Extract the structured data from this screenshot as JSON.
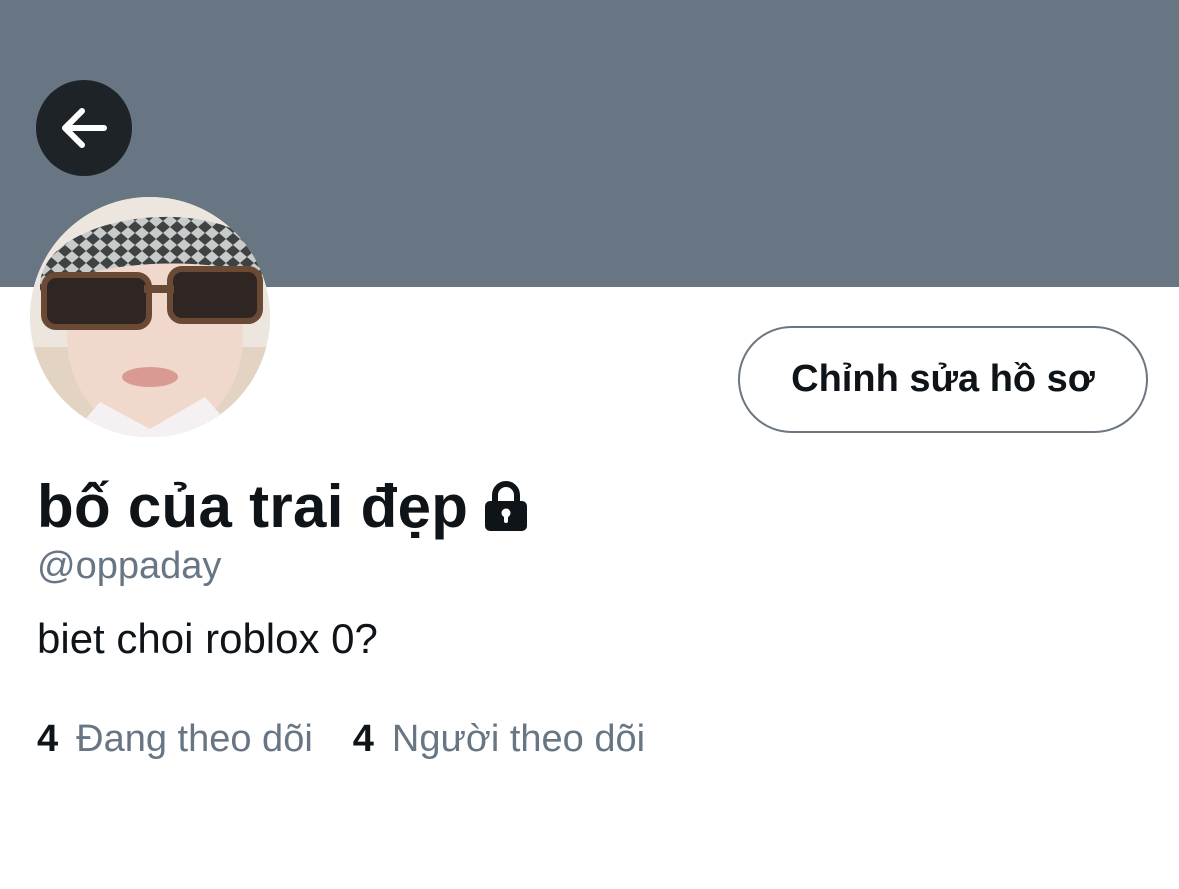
{
  "profile": {
    "display_name": "bố của trai đẹp",
    "handle": "@oppaday",
    "bio": "biet choi roblox 0?",
    "edit_button_label": "Chỉnh sửa hồ sơ",
    "protected_icon": "lock-icon"
  },
  "stats": {
    "following_count": "4",
    "following_label": "Đang theo dõi",
    "followers_count": "4",
    "followers_label": "Người theo dõi"
  },
  "icons": {
    "back": "arrow-left-icon"
  },
  "colors": {
    "banner": "#687684",
    "text_secondary": "#687684",
    "back_button": "#1e2328"
  }
}
